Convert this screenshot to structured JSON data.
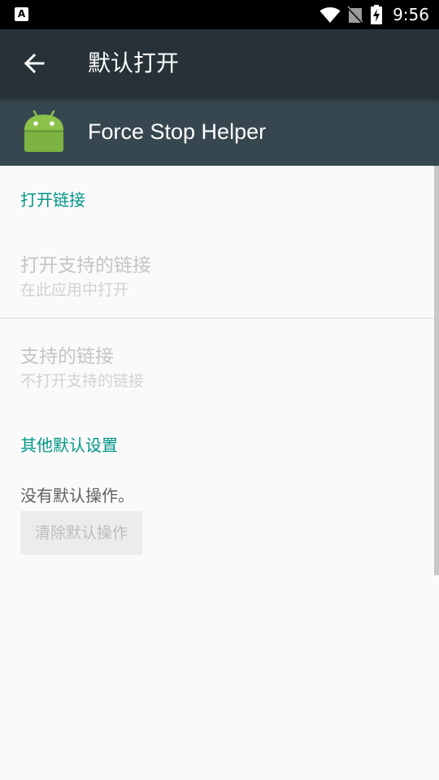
{
  "status_bar": {
    "time": "9:56",
    "icons": [
      "a-notification-icon",
      "wifi-icon",
      "no-sim-icon",
      "battery-charging-icon"
    ]
  },
  "app_bar": {
    "title": "默认打开",
    "back_icon": "arrow-left-icon"
  },
  "app_header": {
    "app_name": "Force Stop Helper",
    "icon": "android-icon",
    "icon_color": "#8bc34a"
  },
  "open_links": {
    "section_title": "打开链接",
    "open_supported": {
      "title": "打开支持的链接",
      "summary": "在此应用中打开"
    },
    "supported_links": {
      "title": "支持的链接",
      "summary": "不打开支持的链接"
    }
  },
  "other_defaults": {
    "section_title": "其他默认设置",
    "message": "没有默认操作。",
    "clear_button": "清除默认操作"
  },
  "colors": {
    "accent": "#009688",
    "app_bar": "#263238",
    "header": "#37474f"
  }
}
